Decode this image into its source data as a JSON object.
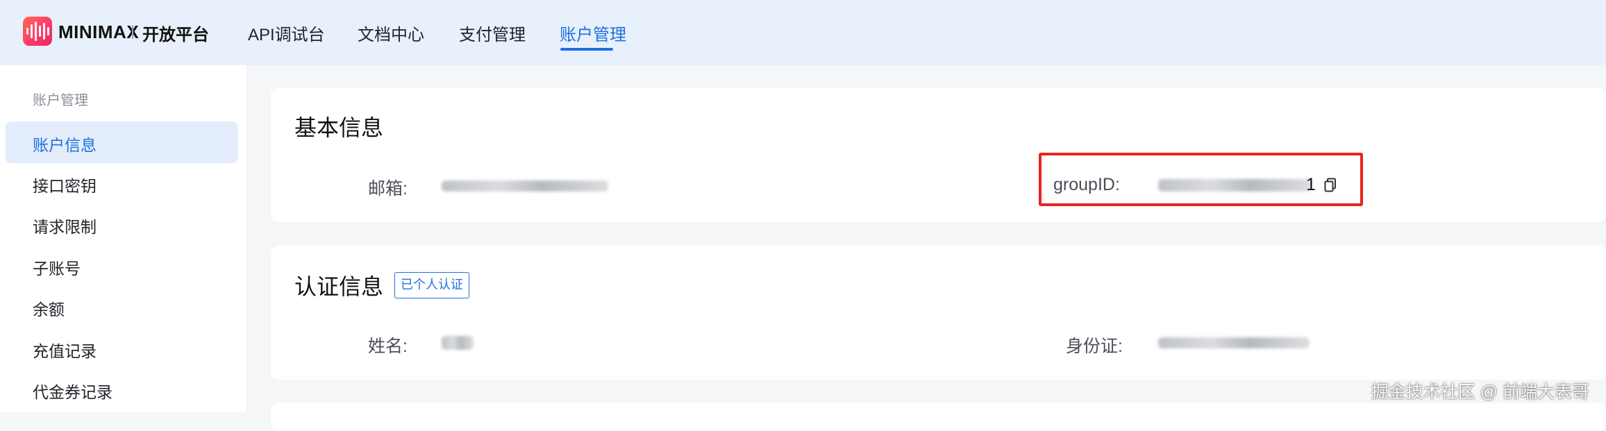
{
  "header": {
    "brand": "MINIMAX",
    "platform": "开放平台",
    "nav": [
      "API调试台",
      "文档中心",
      "支付管理",
      "账户管理"
    ],
    "active_nav": "账户管理"
  },
  "sidebar": {
    "title": "账户管理",
    "items": [
      "账户信息",
      "接口密钥",
      "请求限制",
      "子账号",
      "余额",
      "充值记录",
      "代金券记录"
    ],
    "active": "账户信息"
  },
  "basic_info": {
    "title": "基本信息",
    "email_label": "邮箱:",
    "group_id_label": "groupID:",
    "group_id_suffix": "1"
  },
  "auth_info": {
    "title": "认证信息",
    "badge": "已个人认证",
    "name_label": "姓名:",
    "id_label": "身份证:"
  },
  "watermark": "掘金技术社区 @ 前端大表哥",
  "colors": {
    "accent": "#1f6fe0",
    "highlight": "#e8231c",
    "nav_bg": "#e8f0fb"
  }
}
